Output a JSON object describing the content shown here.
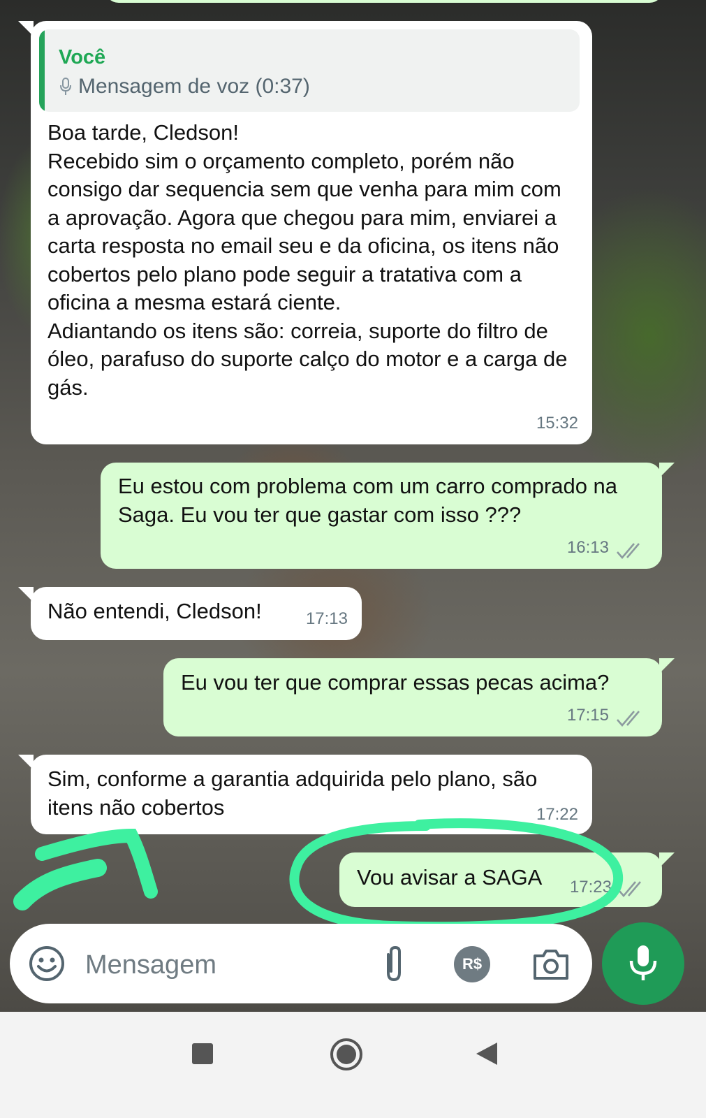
{
  "chat": {
    "messages": [
      {
        "direction": "incoming",
        "quote": {
          "author": "Você",
          "text": "Mensagem de voz (0:37)",
          "icon": "mic-icon"
        },
        "text": "Boa tarde, Cledson!\nRecebido sim o orçamento completo, porém não consigo dar sequencia sem que venha para mim com a aprovação. Agora que chegou para mim, enviarei a carta resposta no email seu e da oficina, os itens não cobertos pelo plano pode seguir a tratativa com a oficina a mesma estará ciente.\nAdiantando os itens são: correia, suporte do filtro de óleo, parafuso do suporte calço do motor e a carga de gás.",
        "time": "15:32"
      },
      {
        "direction": "outgoing",
        "text": "Eu estou com problema com um carro comprado na Saga. Eu vou ter que gastar com isso ???",
        "time": "16:13",
        "status": "read"
      },
      {
        "direction": "incoming",
        "text": "Não entendi, Cledson!",
        "time": "17:13"
      },
      {
        "direction": "outgoing",
        "text": "Eu vou ter que comprar essas pecas acima?",
        "time": "17:15",
        "status": "read"
      },
      {
        "direction": "incoming",
        "text": "Sim, conforme a garantia adquirida pelo plano, são itens não cobertos",
        "time": "17:22"
      },
      {
        "direction": "outgoing",
        "text": "Vou avisar a SAGA",
        "time": "17:23",
        "status": "delivered"
      }
    ]
  },
  "input": {
    "placeholder": "Mensagem",
    "icons": [
      "emoji-icon",
      "attach-icon",
      "payment-icon",
      "camera-icon",
      "mic-icon"
    ],
    "payment_label": "R$"
  },
  "navbar": {
    "icons": [
      "recents-icon",
      "home-icon",
      "back-icon"
    ]
  },
  "colors": {
    "incoming_bubble": "#ffffff",
    "outgoing_bubble": "#d9fdd3",
    "accent_green": "#1f9b57",
    "annotation_highlight": "#3ef0a0"
  }
}
